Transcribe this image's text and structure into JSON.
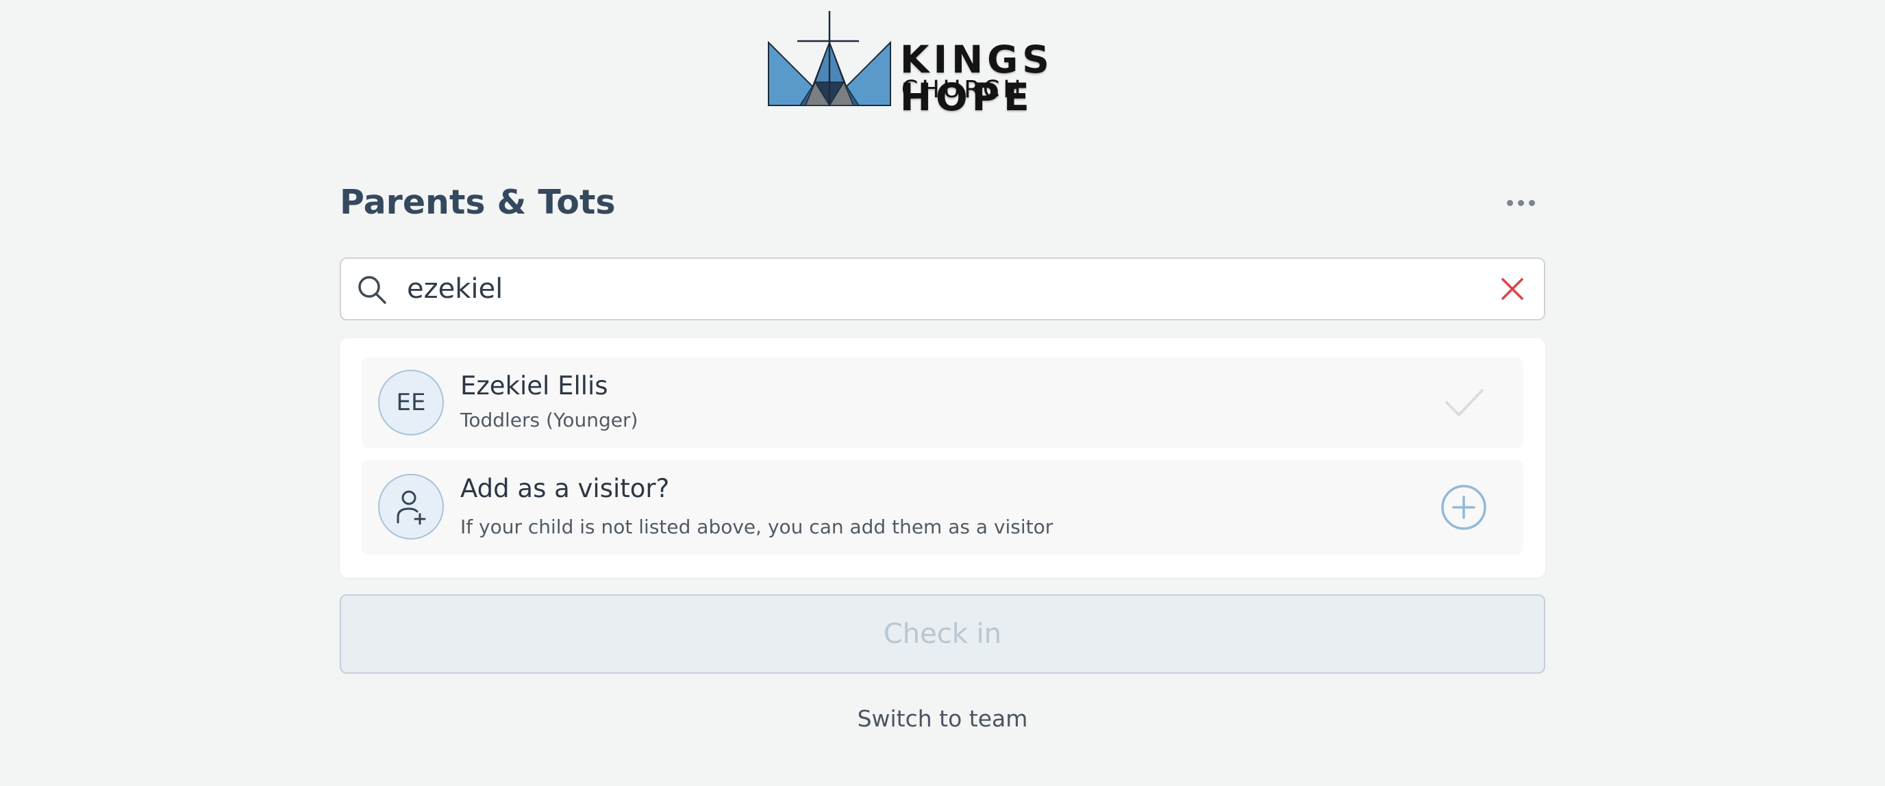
{
  "brand": {
    "name_line1": "KINGS HOPE",
    "name_line2": "CHURCH",
    "logo_icon": "crown-cross-logo-icon",
    "colors": {
      "light_blue": "#5b9bcc",
      "dark_blue": "#2f5f89",
      "navy": "#233a55",
      "grey": "#7c7f84"
    }
  },
  "header": {
    "title": "Parents & Tots",
    "more_icon": "more-horizontal-icon"
  },
  "search": {
    "value": "ezekiel",
    "placeholder": "",
    "search_icon": "search-icon",
    "clear_icon": "close-icon",
    "clear_color": "#d9434b"
  },
  "results": [
    {
      "initials": "EE",
      "name": "Ezekiel Ellis",
      "group": "Toddlers (Younger)",
      "selected": false,
      "action_icon": "check-icon"
    }
  ],
  "visitor": {
    "title": "Add as a visitor?",
    "description": "If your child is not listed above, you can add them as a visitor",
    "avatar_icon": "add-user-icon",
    "action_icon": "add-circle-icon"
  },
  "actions": {
    "checkin_label": "Check in",
    "checkin_enabled": false,
    "switch_label": "Switch to team"
  },
  "colors": {
    "background": "#f3f4f4",
    "accent": "#8fb6d8",
    "title": "#34495e"
  }
}
